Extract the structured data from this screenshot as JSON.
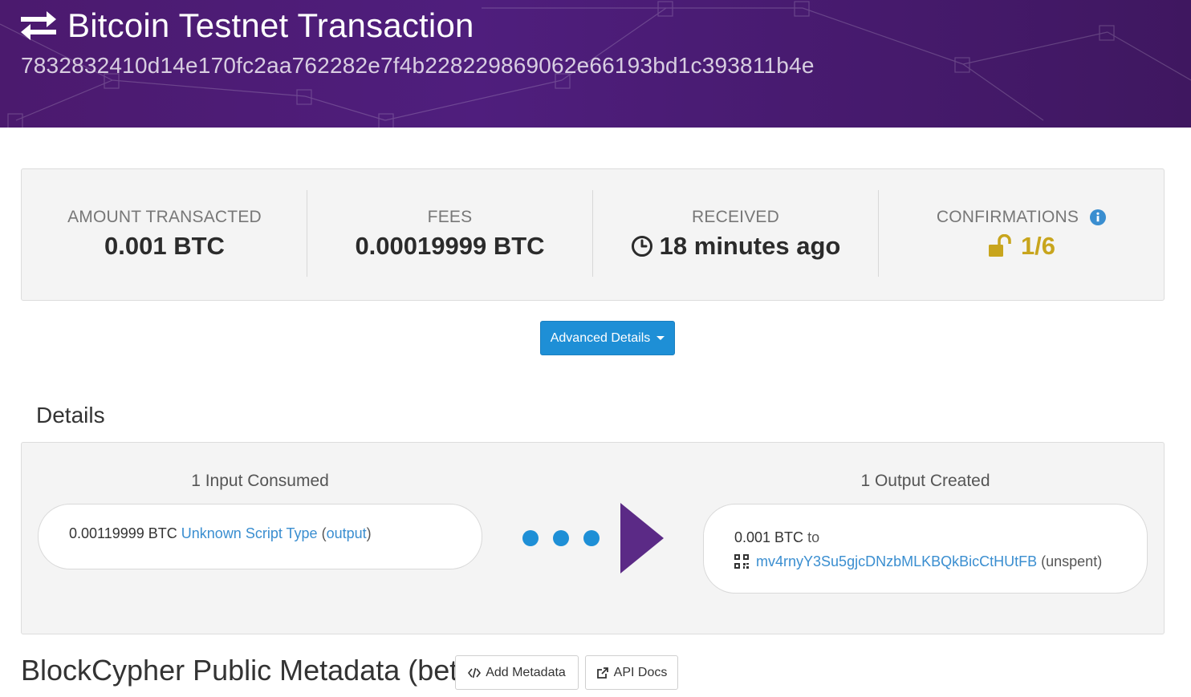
{
  "header": {
    "title": "Bitcoin Testnet Transaction",
    "hash": "7832832410d14e170fc2aa762282e7f4b228229869062e66193bd1c393811b4e",
    "icon": "exchange-arrows-icon"
  },
  "summary": {
    "amount": {
      "label": "AMOUNT TRANSACTED",
      "value": "0.001 BTC"
    },
    "fees": {
      "label": "FEES",
      "value": "0.00019999 BTC"
    },
    "received": {
      "label": "RECEIVED",
      "value": "18 minutes ago",
      "icon": "clock-icon"
    },
    "confirmations": {
      "label": "CONFIRMATIONS",
      "value": "1/6",
      "icon": "unlock-icon",
      "info_icon": "info-circle-icon",
      "color": "#c8a51d"
    }
  },
  "advanced_button": {
    "label": "Advanced Details"
  },
  "details": {
    "heading": "Details",
    "inputs": {
      "title": "1 Input Consumed",
      "amount": "0.00119999 BTC",
      "script_type": "Unknown Script Type",
      "open_paren": "(",
      "output_link": "output",
      "close_paren": ")"
    },
    "outputs": {
      "title": "1 Output Created",
      "amount": "0.001 BTC",
      "to": "to",
      "address": "mv4rnyY3Su5gjcDNzbMLKBQkBicCtHUtFB",
      "status": "(unspent)"
    }
  },
  "metadata": {
    "heading": "BlockCypher Public Metadata (beta)",
    "add_button": "Add Metadata",
    "api_button": "API Docs"
  },
  "colors": {
    "header_bg": "#4b1a6e",
    "accent_blue": "#1e8fd6",
    "confirm_gold": "#c8a51d",
    "arrow_purple": "#5b2a86"
  }
}
